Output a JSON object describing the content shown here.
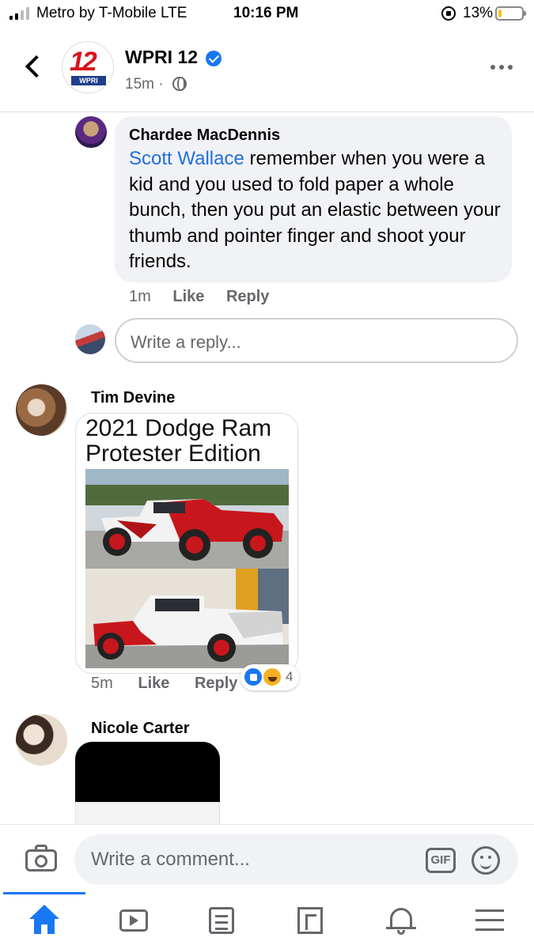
{
  "status_bar": {
    "carrier": "Metro by T-Mobile  LTE",
    "time": "10:16 PM",
    "battery": "13%",
    "battery_level": 0.13
  },
  "header": {
    "page_name": "WPRI 12",
    "logo_number": "12",
    "logo_text": "WPRI",
    "post_time": "15m ·",
    "icons": [
      "back-icon",
      "verified-icon",
      "globe-icon",
      "more-icon"
    ]
  },
  "comments": [
    {
      "author": "Chardee MacDennis",
      "mention": "Scott Wallace",
      "text": " remember when you were a kid and you used to fold paper a whole bunch, then you put an elastic between your thumb and pointer finger and shoot your friends.",
      "time": "1m",
      "like_label": "Like",
      "reply_label": "Reply"
    },
    {
      "author": "Tim Devine",
      "image_title": "2021 Dodge Ram Protester Edition",
      "time": "5m",
      "like_label": "Like",
      "reply_label": "Reply",
      "reaction_count": "4",
      "reactions": [
        "like",
        "haha"
      ]
    },
    {
      "author": "Nicole Carter"
    }
  ],
  "reply_box": {
    "placeholder": "Write a reply..."
  },
  "composer": {
    "placeholder": "Write a comment...",
    "gif_label": "GIF"
  },
  "tab_bar": {
    "tabs": [
      "home-icon",
      "watch-icon",
      "news-feed-icon",
      "pages-icon",
      "notifications-icon",
      "menu-icon"
    ],
    "active": "home-icon",
    "active_color": "#1877f2"
  },
  "colors": {
    "link": "#216fdb",
    "bubble": "#f0f2f5",
    "secondary_text": "#65676b"
  }
}
